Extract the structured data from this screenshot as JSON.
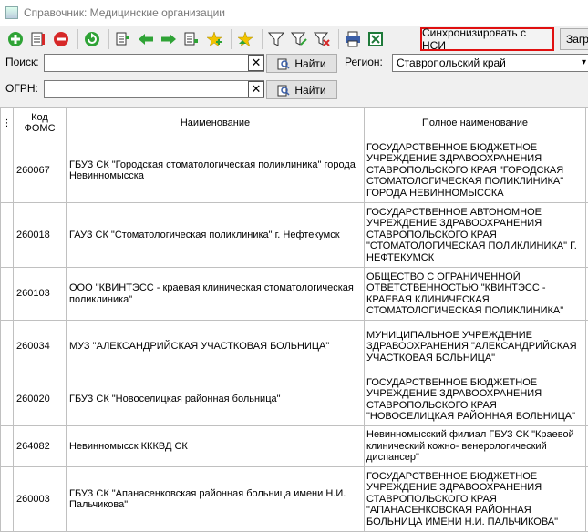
{
  "window": {
    "title": "Справочник: Медицинские организации"
  },
  "toolbar": {
    "icons": [
      "add-icon",
      "edit-icon",
      "delete-icon",
      "refresh-icon",
      "copy-icon",
      "arrow-left-icon",
      "arrow-right-icon",
      "paste-icon",
      "star-add-icon",
      "star-icon",
      "filter-icon",
      "filter-edit-icon",
      "filter-clear-icon",
      "print-icon",
      "excel-icon"
    ],
    "sync_label": "Синхронизировать с НСИ",
    "load_label": "Загр"
  },
  "search": {
    "label": "Поиск:",
    "value": "",
    "find_label": "Найти"
  },
  "region": {
    "label": "Регион:",
    "value": "Ставропольский край"
  },
  "ogrn": {
    "label": "ОГРН:",
    "value": "",
    "find_label": "Найти"
  },
  "table": {
    "columns": [
      "Код ФОМС",
      "Наименование",
      "Полное наименование"
    ],
    "rows": [
      {
        "code": "260067",
        "name": "ГБУЗ СК \"Городская стоматологическая поликлиника\" города Невинномысска",
        "full": "ГОСУДАРСТВЕННОЕ БЮДЖЕТНОЕ УЧРЕЖДЕНИЕ ЗДРАВООХРАНЕНИЯ СТАВРОПОЛЬСКОГО КРАЯ \"ГОРОДСКАЯ СТОМАТОЛОГИЧЕСКАЯ ПОЛИКЛИНИКА\" ГОРОДА НЕВИННОМЫССКА"
      },
      {
        "code": "260018",
        "name": "ГАУЗ СК \"Стоматологическая поликлиника\" г. Нефтекумск",
        "full": "ГОСУДАРСТВЕННОЕ АВТОНОМНОЕ УЧРЕЖДЕНИЕ ЗДРАВООХРАНЕНИЯ СТАВРОПОЛЬСКОГО КРАЯ \"СТОМАТОЛОГИЧЕСКАЯ ПОЛИКЛИНИКА\" Г. НЕФТЕКУМСК"
      },
      {
        "code": "260103",
        "name": "ООО \"КВИНТЭСС - краевая клиническая стоматологическая поликлиника\"",
        "full": "ОБЩЕСТВО С ОГРАНИЧЕННОЙ ОТВЕТСТВЕННОСТЬЮ \"КВИНТЭСС - КРАЕВАЯ КЛИНИЧЕСКАЯ СТОМАТОЛОГИЧЕСКАЯ ПОЛИКЛИНИКА\""
      },
      {
        "code": "260034",
        "name": "МУЗ \"АЛЕКСАНДРИЙСКАЯ УЧАСТКОВАЯ БОЛЬНИЦА\"",
        "full": "МУНИЦИПАЛЬНОЕ УЧРЕЖДЕНИЕ ЗДРАВООХРАНЕНИЯ \"АЛЕКСАНДРИЙСКАЯ УЧАСТКОВАЯ БОЛЬНИЦА\""
      },
      {
        "code": "260020",
        "name": "ГБУЗ СК \"Новоселицкая районная больница\"",
        "full": "ГОСУДАРСТВЕННОЕ БЮДЖЕТНОЕ УЧРЕЖДЕНИЕ ЗДРАВООХРАНЕНИЯ СТАВРОПОЛЬСКОГО КРАЯ \"НОВОСЕЛИЦКАЯ РАЙОННАЯ БОЛЬНИЦА\""
      },
      {
        "code": "264082",
        "name": "Невинномысск КККВД СК",
        "full": "Невинномысский филиал ГБУЗ СК \"Краевой клинический кожно- венерологический диспансер\""
      },
      {
        "code": "260003",
        "name": "ГБУЗ СК \"Апанасенковская районная больница имени Н.И. Пальчикова\"",
        "full": "ГОСУДАРСТВЕННОЕ БЮДЖЕТНОЕ УЧРЕЖДЕНИЕ ЗДРАВООХРАНЕНИЯ СТАВРОПОЛЬСКОГО КРАЯ \"АПАНАСЕНКОВСКАЯ РАЙОННАЯ БОЛЬНИЦА ИМЕНИ Н.И. ПАЛЬЧИКОВА\""
      }
    ]
  },
  "colors": {
    "highlight_border": "#e01010",
    "green": "#2fa336",
    "red": "#d62828"
  }
}
